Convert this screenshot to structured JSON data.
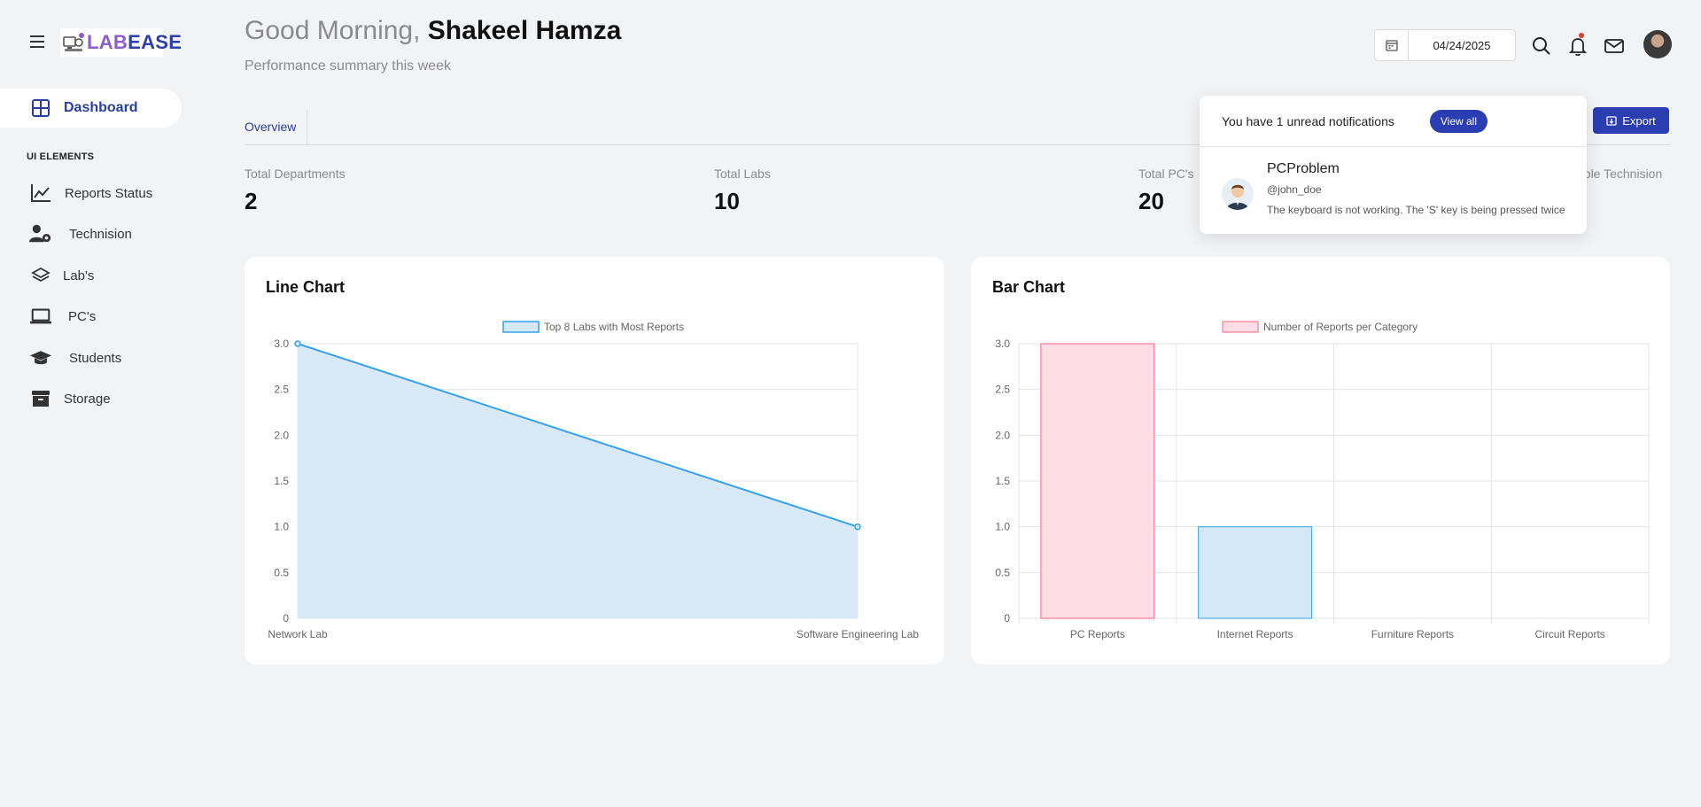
{
  "brand": {
    "part1": "LAB",
    "part2": "EASE"
  },
  "sidebar": {
    "active": {
      "label": "Dashboard"
    },
    "section_title": "UI ELEMENTS",
    "items": [
      {
        "label": "Reports Status",
        "icon": "line-chart-icon"
      },
      {
        "label": "Technision",
        "icon": "user-gear-icon"
      },
      {
        "label": "Lab's",
        "icon": "layers-icon"
      },
      {
        "label": "PC's",
        "icon": "laptop-icon"
      },
      {
        "label": "Students",
        "icon": "graduation-cap-icon"
      },
      {
        "label": "Storage",
        "icon": "archive-icon"
      }
    ]
  },
  "header": {
    "greeting": "Good Morning,",
    "user_name": "Shakeel Hamza",
    "subtitle": "Performance summary this week",
    "date": "04/24/2025"
  },
  "tabs": [
    {
      "label": "Overview"
    }
  ],
  "export_label": "Export",
  "stats": [
    {
      "label": "Total Departments",
      "value": "2"
    },
    {
      "label": "Total Labs",
      "value": "10"
    },
    {
      "label": "Total PC's",
      "value": "20"
    },
    {
      "label": "able Technision",
      "value": ""
    }
  ],
  "notifications": {
    "header": "You have 1 unread notifications",
    "view_all": "View all",
    "items": [
      {
        "title": "PCProblem",
        "user": "@john_doe",
        "message": "The keyboard is not working. The 'S' key is being pressed twice"
      }
    ]
  },
  "cards": {
    "line_title": "Line Chart",
    "bar_title": "Bar Chart"
  },
  "colors": {
    "accent": "#2a3eb1",
    "line": "#36a2eb",
    "line_fill": "#d4e8f7",
    "bar_pink": "#ffdde4",
    "bar_pink_border": "#ff6384"
  },
  "chart_data": [
    {
      "type": "area",
      "title": "Line Chart",
      "categories": [
        "Network Lab",
        "Software Engineering Lab"
      ],
      "series": [
        {
          "name": "Top 8 Labs with Most Reports",
          "values": [
            3,
            1
          ]
        }
      ],
      "ylim": [
        0,
        3
      ],
      "yticks": [
        "0",
        "0.5",
        "1.0",
        "1.5",
        "2.0",
        "2.5",
        "3.0"
      ],
      "legend": "top-center",
      "grid": true
    },
    {
      "type": "bar",
      "title": "Bar Chart",
      "categories": [
        "PC Reports",
        "Internet Reports",
        "Furniture Reports",
        "Circuit Reports"
      ],
      "series": [
        {
          "name": "Number of Reports per Category",
          "values": [
            3,
            1,
            0,
            0
          ]
        }
      ],
      "ylim": [
        0,
        3
      ],
      "yticks": [
        "0",
        "0.5",
        "1.0",
        "1.5",
        "2.0",
        "2.5",
        "3.0"
      ],
      "legend": "top-center",
      "grid": true
    }
  ]
}
